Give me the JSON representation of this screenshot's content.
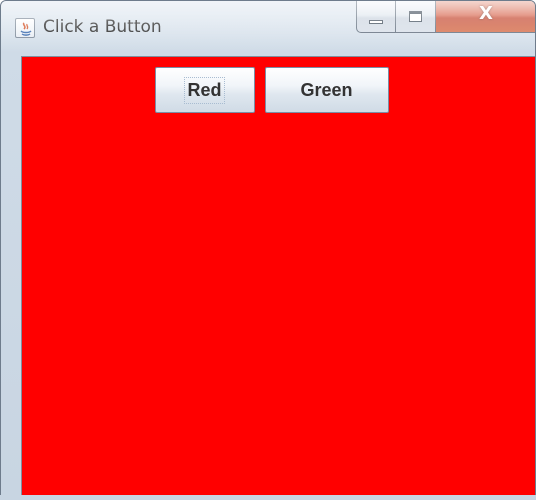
{
  "window": {
    "title": "Click a Button",
    "icon": "java-icon",
    "close_glyph": "X",
    "content_background": "#ff0000"
  },
  "buttons": {
    "red_label": "Red",
    "green_label": "Green"
  },
  "icons": [
    "java-icon",
    "minimize-icon",
    "maximize-icon",
    "close-icon"
  ]
}
